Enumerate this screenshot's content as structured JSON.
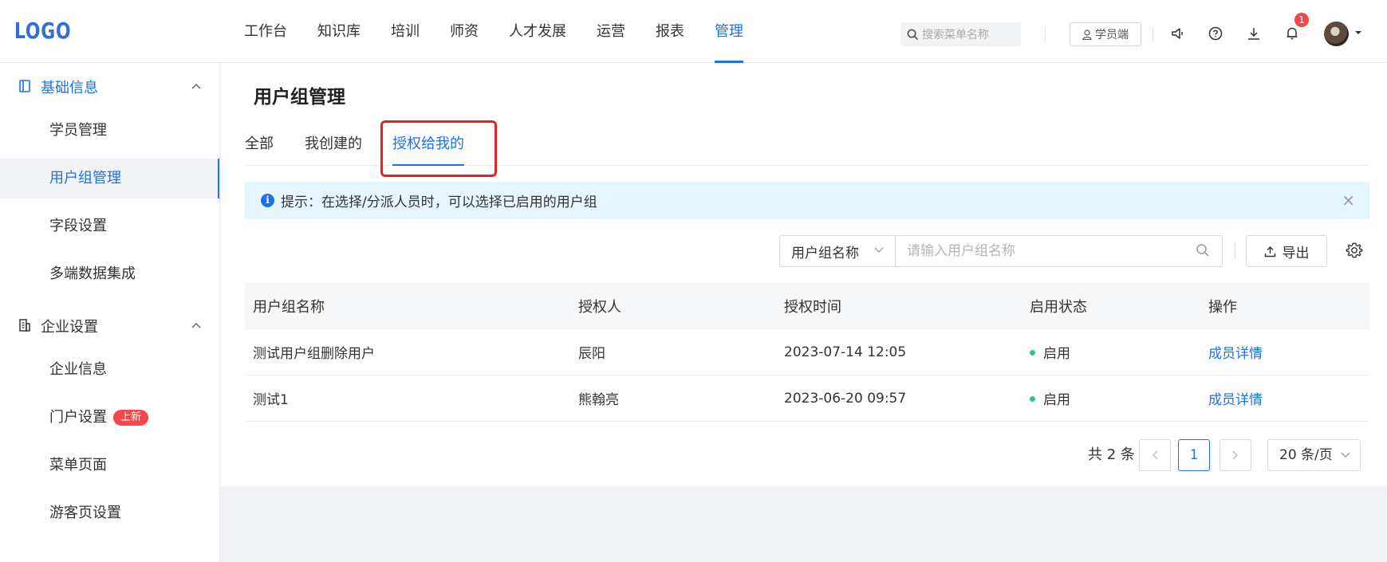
{
  "topbar": {
    "logo": "LOGO",
    "nav": [
      "工作台",
      "知识库",
      "培训",
      "师资",
      "人才发展",
      "运营",
      "报表",
      "管理"
    ],
    "nav_active": "管理",
    "search_placeholder": "搜索菜单名称",
    "student_portal": "学员端",
    "notification_count": "1",
    "icons": [
      "search-icon",
      "user-icon",
      "megaphone-icon",
      "help-icon",
      "download-icon",
      "bell-icon",
      "avatar",
      "caret-down-icon"
    ]
  },
  "sidebar": {
    "group1": {
      "label": "基础信息",
      "icon": "book-icon"
    },
    "group1_items": [
      "学员管理",
      "用户组管理",
      "字段设置",
      "多端数据集成"
    ],
    "group2": {
      "label": "企业设置",
      "icon": "building-icon"
    },
    "group2_items": [
      "企业信息",
      "门户设置",
      "菜单页面",
      "游客页设置"
    ],
    "new_tag": "上新",
    "active_item": "用户组管理"
  },
  "main": {
    "title": "用户组管理",
    "tabs": [
      "全部",
      "我创建的",
      "授权给我的"
    ],
    "active_tab": "授权给我的",
    "tip": "提示：在选择/分派人员时，可以选择已启用的用户组",
    "filter": {
      "field": "用户组名称",
      "placeholder": "请输入用户组名称"
    },
    "export_label": "导出",
    "table": {
      "headers": [
        "用户组名称",
        "授权人",
        "授权时间",
        "启用状态",
        "操作"
      ],
      "rows": [
        {
          "name": "测试用户组删除用户",
          "grantor": "辰阳",
          "time": "2023-07-14 12:05",
          "status": "启用",
          "action": "成员详情"
        },
        {
          "name": "测试1",
          "grantor": "熊翰亮",
          "time": "2023-06-20 09:57",
          "status": "启用",
          "action": "成员详情"
        }
      ]
    },
    "pagination": {
      "total": "共 2 条",
      "current_page": "1",
      "page_size": "20 条/页"
    }
  },
  "colors": {
    "accent": "#1a73e8",
    "highlight": "#e3241c",
    "badge": "#f5474b",
    "status_ok": "#2bc48a"
  }
}
